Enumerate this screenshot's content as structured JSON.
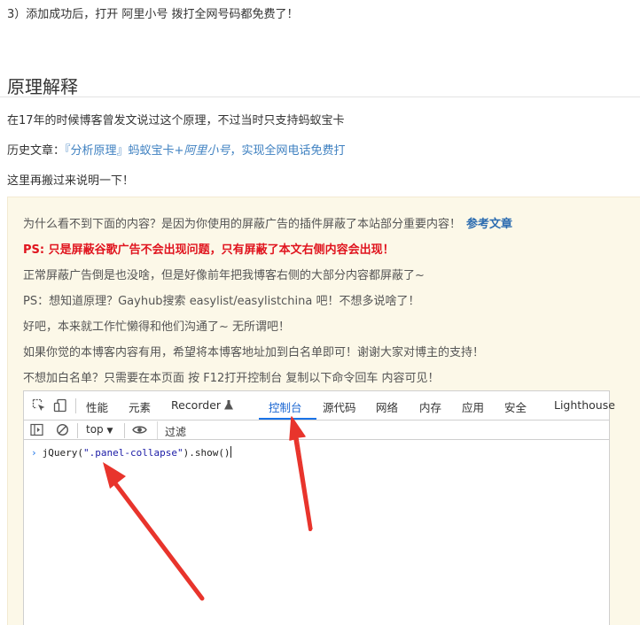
{
  "article": {
    "step3": "3）添加成功后，打开 阿里小号 拨打全网号码都免费了！",
    "section_title": "原理解释",
    "p1": "在17年的时候博客曾发文说过这个原理，不过当时只支持蚂蚁宝卡",
    "history_prefix": "历史文章：",
    "history_link_a": "『分析原理』蚂蚁宝卡+",
    "history_link_b": "阿里小号",
    "history_link_c": "，实现全网电话免费打",
    "p3": "这里再搬过来说明一下！"
  },
  "notice": {
    "line1": "为什么看不到下面的内容？是因为你使用的屏蔽广告的插件屏蔽了本站部分重要内容！",
    "ref_link": "参考文章",
    "line2": "PS: 只是屏蔽谷歌广告不会出现问题，只有屏蔽了本文右侧内容会出现！",
    "line3": "正常屏蔽广告倒是也没啥，但是好像前年把我博客右侧的大部分内容都屏蔽了~",
    "line4": "PS：想知道原理？Gayhub搜索 easylist/easylistchina 吧！不想多说啥了！",
    "line5": "好吧，本来就工作忙懒得和他们沟通了~ 无所谓吧！",
    "line6": "如果你觉的本博客内容有用，希望将本博客地址加到白名单即可！谢谢大家对博主的支持！",
    "line7": "不想加白名单？只需要在本页面 按 F12打开控制台 复制以下命令回车   内容可见！"
  },
  "devtools": {
    "tabs": [
      "性能",
      "元素",
      "Recorder",
      "控制台",
      "源代码",
      "网络",
      "内存",
      "应用",
      "安全",
      "Lighthouse"
    ],
    "active_tab": "控制台",
    "context": "top",
    "filter_placeholder": "过滤",
    "console_prefix": "jQuery(",
    "console_string": "\".panel-collapse\"",
    "console_suffix": ").show()"
  },
  "colors": {
    "link": "#3f81c1",
    "notice_bg": "#fcf8e8",
    "warning_red": "#e0141e",
    "devtools_active": "#1a73e8",
    "annotation_arrow": "#e8342c"
  },
  "icons": [
    "inspect-icon",
    "device-toggle-icon",
    "recorder-flask-icon",
    "sidebar-toggle-icon",
    "clear-console-icon",
    "dropdown-caret-icon",
    "live-expression-eye-icon",
    "console-prompt-icon"
  ]
}
